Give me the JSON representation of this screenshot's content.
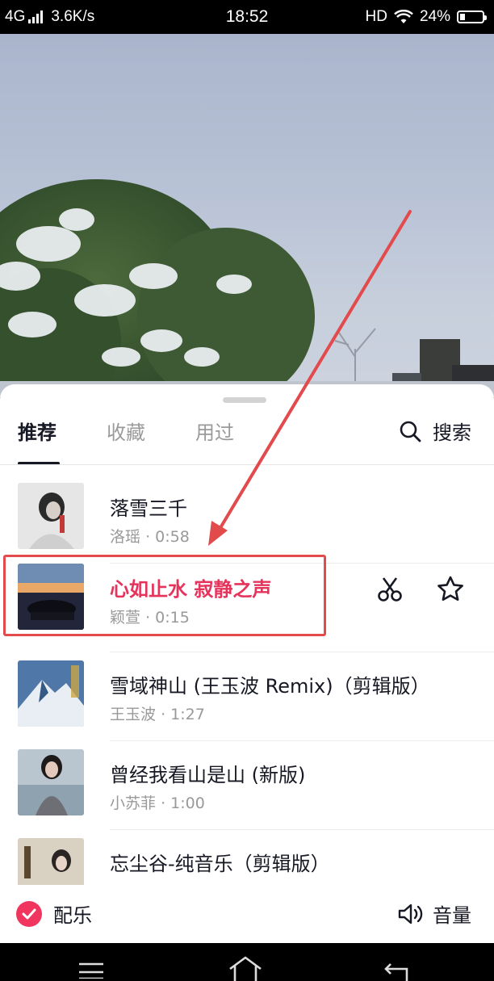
{
  "status_bar": {
    "network": "4G",
    "speed": "3.6K/s",
    "time": "18:52",
    "hd": "HD",
    "battery": "24%",
    "battery_level": 0.24
  },
  "tabs": [
    {
      "label": "推荐",
      "active": true
    },
    {
      "label": "收藏",
      "active": false
    },
    {
      "label": "用过",
      "active": false
    }
  ],
  "search": {
    "label": "搜索",
    "icon": "search-icon"
  },
  "songs": [
    {
      "title": "落雪三千",
      "artist": "洛瑶",
      "duration": "0:58",
      "selected": false
    },
    {
      "title": "心如止水 寂静之声",
      "artist": "颖萱",
      "duration": "0:15",
      "selected": true
    },
    {
      "title": "雪域神山 (王玉波 Remix)（剪辑版）",
      "artist": "王玉波",
      "duration": "1:27",
      "selected": false
    },
    {
      "title": "曾经我看山是山 (新版)",
      "artist": "小苏菲",
      "duration": "1:00",
      "selected": false
    },
    {
      "title": "忘尘谷-纯音乐（剪辑版）",
      "artist": "",
      "duration": "",
      "selected": false
    }
  ],
  "meta_separator": "·",
  "row_actions": {
    "cut_icon": "scissors-icon",
    "favorite_icon": "star-icon"
  },
  "bottom": {
    "music_label": "配乐",
    "volume_label": "音量",
    "volume_icon": "speaker-icon"
  },
  "colors": {
    "accent": "#f0365f",
    "selected_title": "#e6335c",
    "annotation": "#e34a4c"
  }
}
